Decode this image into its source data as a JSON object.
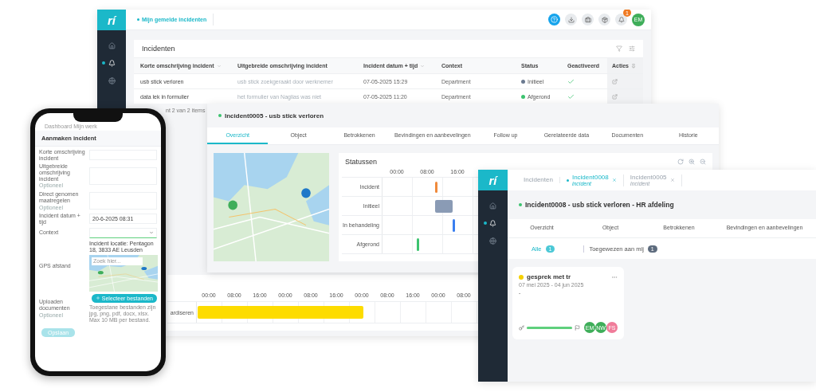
{
  "main_window": {
    "logo": "rí",
    "sidebar": [
      {
        "selected": false
      },
      {
        "selected": true
      },
      {
        "selected": false
      }
    ],
    "page_tab": {
      "label": "Mijn gemelde incidenten",
      "selected": true
    },
    "notification_count": "1",
    "avatar": "EM",
    "panel_title": "Incidenten",
    "table": {
      "columns": [
        "Korte omschrijving incident",
        "Uitgebreide omschrijving incident",
        "Incident datum + tijd",
        "Context",
        "Status",
        "Geactiveerd",
        "Acties"
      ],
      "rows": [
        {
          "short": "usb stick verloren",
          "long": "usb stick zoekgeraakt door werknemer",
          "datetime": "07-05-2025 15:29",
          "context": "Department",
          "status": "Initieel",
          "color": "#6b7a90",
          "activated": true
        },
        {
          "short": "data lek in formulier",
          "long": "het formulier van Naglias was niet",
          "datetime": "07-05-2025 11:20",
          "context": "Department",
          "status": "Afgerond",
          "color": "#3cc36f",
          "activated": true
        }
      ]
    },
    "pagination": "nt 2 van 2 items"
  },
  "incident_window": {
    "title": "Incident0005 - usb stick verloren",
    "tabs": [
      {
        "label": "Overzicht",
        "selected": true
      },
      {
        "label": "Object",
        "selected": false
      },
      {
        "label": "Betrokkenen",
        "selected": false
      },
      {
        "label": "Bevindingen en aanbevelingen",
        "selected": false
      },
      {
        "label": "Follow up",
        "selected": false
      },
      {
        "label": "Gerelateerde data",
        "selected": false
      },
      {
        "label": "Documenten",
        "selected": false
      },
      {
        "label": "Historie",
        "selected": false
      }
    ],
    "status_panel": {
      "title": "Statussen",
      "ticks": [
        "00:00",
        "08:00",
        "16:00"
      ],
      "rows": [
        {
          "label": "Incident",
          "color": "#f08a3c"
        },
        {
          "label": "Initieel",
          "color": "#8a9bb5"
        },
        {
          "label": "In behandeling",
          "color": "#3a7ff0"
        },
        {
          "label": "Afgerond",
          "color": "#3cc36f"
        }
      ]
    }
  },
  "timeline": {
    "ticks": [
      "00:00",
      "08:00",
      "16:00",
      "00:00",
      "08:00",
      "16:00",
      "00:00",
      "08:00",
      "16:00",
      "00:00",
      "08:00"
    ],
    "row_label": "ardiseren"
  },
  "detail_window": {
    "logo": "rí",
    "sidebar": [
      {
        "selected": false
      },
      {
        "selected": true
      },
      {
        "selected": false
      }
    ],
    "open_tabs": [
      {
        "label": "Incidenten",
        "selected": false
      },
      {
        "label": "Incident0008",
        "sub": "incident",
        "selected": true
      },
      {
        "label": "Incident0005",
        "sub": "Incident",
        "selected": false
      }
    ],
    "title": "Incident0008 - usb stick verloren - HR afdeling",
    "tabs": [
      {
        "label": "Overzicht",
        "selected": false
      },
      {
        "label": "Object",
        "selected": false
      },
      {
        "label": "Betrokkenen",
        "selected": false
      },
      {
        "label": "Bevindingen en aanbevelingen",
        "selected": false
      }
    ],
    "filters": [
      {
        "label": "Alle",
        "count": "1",
        "selected": true
      },
      {
        "label": "Toegewezen aan mij",
        "count": "1",
        "selected": false
      }
    ],
    "cards": [
      {
        "title": "gesprek met tr",
        "dates": "07 mei 2025 - 04 jun 2025",
        "description": "-",
        "color": "#f5d000",
        "level": 1,
        "avatars": [
          {
            "initials": "EM",
            "color": "#3fae5a"
          },
          {
            "initials": "NW",
            "color": "#3fae5a"
          },
          {
            "initials": "FS",
            "color": "#f07c9a"
          }
        ]
      }
    ]
  },
  "phone": {
    "status_bar": "Dashboard Mijn werk",
    "title": "Aanmaken incident",
    "fields": [
      {
        "kind": "text",
        "label": "Korte omschrijving incident"
      },
      {
        "kind": "textarea",
        "label": "Uitgebreide omschrijving incident",
        "hint": "Optioneel"
      },
      {
        "kind": "textarea",
        "label": "Direct genomen maatregelen",
        "hint": "Optioneel"
      },
      {
        "kind": "text",
        "label": "Incident datum + tijd",
        "value": "20-6-2025 08:31"
      },
      {
        "kind": "select",
        "label": "Context"
      },
      {
        "kind": "map",
        "label": "GPS afstand",
        "location": "Incident locatie: Pentagon 18, 3833 AE Leusden",
        "placeholder": "Zoek hier..."
      },
      {
        "kind": "upload",
        "label": "Uploaden documenten",
        "hint": "Optioneel",
        "button": "Selecteer bestanden",
        "note": "Toegestane bestanden zijn jpg, png, pdf, docx, xlsx. Max 10 MB per bestand."
      }
    ],
    "submit": "Opslaan"
  }
}
